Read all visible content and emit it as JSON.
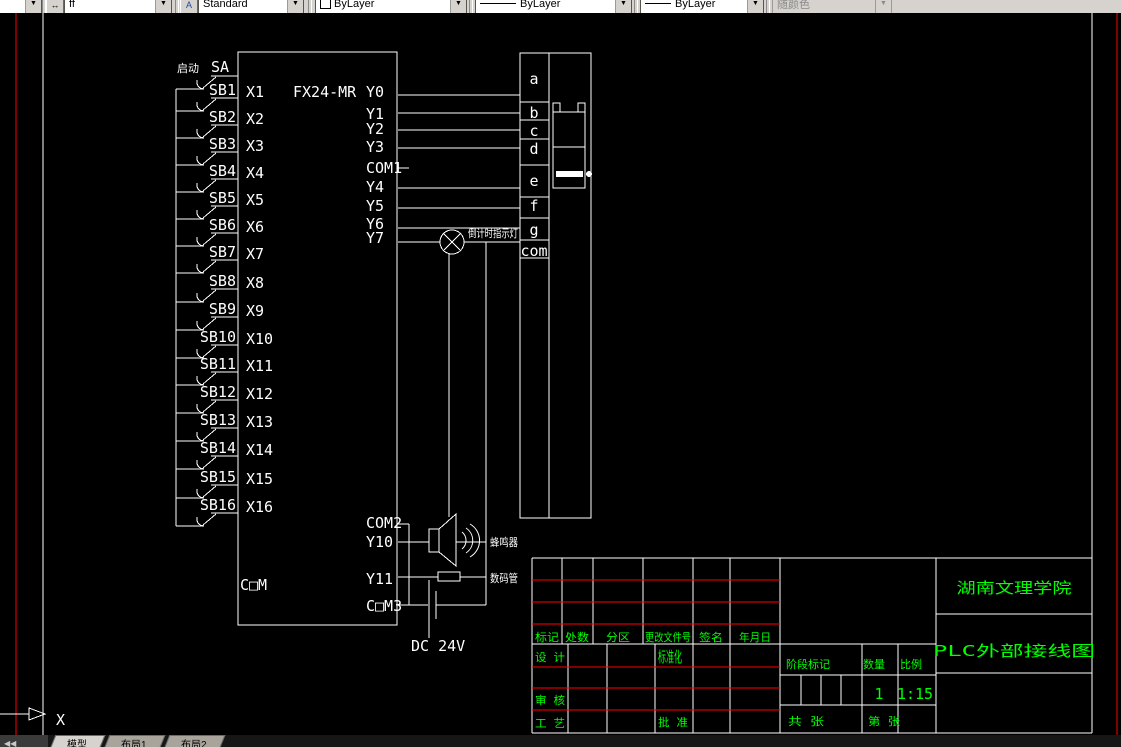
{
  "toolbar": {
    "dim_style": {
      "value": "ff"
    },
    "text_style": {
      "value": "Standard"
    },
    "color_control": {
      "value": "ByLayer"
    },
    "linetype_control": {
      "value": "ByLayer"
    },
    "lineweight_control": {
      "value": "ByLayer"
    },
    "plot_style_control": {
      "value": "随颜色"
    }
  },
  "diagram": {
    "plc_model": "FX24-MR",
    "start_label": "启动",
    "master_switch": "SA",
    "input_com": "C□M",
    "inputs": [
      {
        "switch": "SB1",
        "pin": "X1"
      },
      {
        "switch": "SB2",
        "pin": "X2"
      },
      {
        "switch": "SB3",
        "pin": "X3"
      },
      {
        "switch": "SB4",
        "pin": "X4"
      },
      {
        "switch": "SB5",
        "pin": "X5"
      },
      {
        "switch": "SB6",
        "pin": "X6"
      },
      {
        "switch": "SB7",
        "pin": "X7"
      },
      {
        "switch": "SB8",
        "pin": "X8"
      },
      {
        "switch": "SB9",
        "pin": "X9"
      },
      {
        "switch": "SB10",
        "pin": "X10"
      },
      {
        "switch": "SB11",
        "pin": "X11"
      },
      {
        "switch": "SB12",
        "pin": "X12"
      },
      {
        "switch": "SB13",
        "pin": "X13"
      },
      {
        "switch": "SB14",
        "pin": "X14"
      },
      {
        "switch": "SB15",
        "pin": "X15"
      },
      {
        "switch": "SB16",
        "pin": "X16"
      }
    ],
    "outputs_top": [
      "Y0",
      "Y1",
      "Y2",
      "Y3",
      "COM1",
      "Y4",
      "Y5",
      "Y6",
      "Y7"
    ],
    "outputs_bottom": [
      "COM2",
      "Y10",
      "Y11",
      "C□M3"
    ],
    "terminals": [
      "a",
      "b",
      "c",
      "d",
      "e",
      "f",
      "g",
      "com"
    ],
    "lamp_label": "倒计时指示灯",
    "buzzer_label": "蜂鸣器",
    "display_label": "数码管",
    "power_label": "DC 24V"
  },
  "title_block": {
    "revision_headers": [
      "标记",
      "处数",
      "分区",
      "更改文件号",
      "签名",
      "年月日"
    ],
    "design": "设 计",
    "standardization": "标准化",
    "review": "审 核",
    "process": "工 艺",
    "approve": "批 准",
    "stage_mark": "阶段标记",
    "quantity_label": "数量",
    "scale_label": "比例",
    "quantity_value": "1",
    "scale_value": "1:15",
    "total_sheets": "共 张",
    "sheet_no": "第 张",
    "organization": "湖南文理学院",
    "drawing_title": "PLC外部接线图"
  },
  "ucs": {
    "x_axis": "X"
  },
  "status_tabs": [
    "模型",
    "布局1",
    "布局2"
  ],
  "colors": {
    "line": "#ffffff",
    "grid_red": "#ff0000",
    "text_green": "#00ff00",
    "toolbar_bg": "#d6d3ce"
  }
}
